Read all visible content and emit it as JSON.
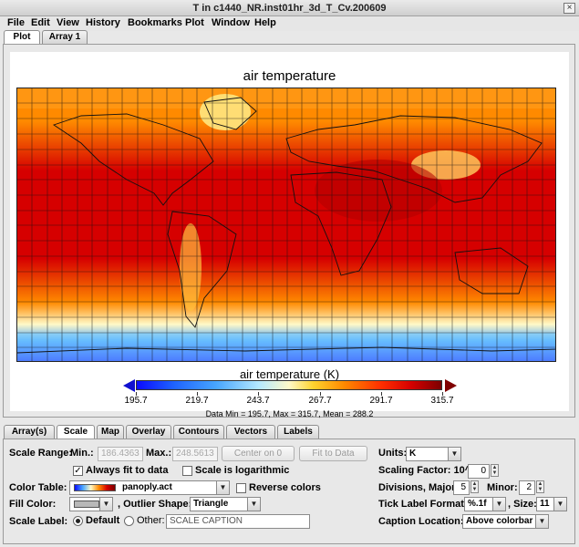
{
  "window": {
    "title": "T in c1440_NR.inst01hr_3d_T_Cv.200609",
    "close_glyph": "×"
  },
  "menu": [
    "File",
    "Edit",
    "View",
    "History",
    "Bookmarks",
    "Plot",
    "Window",
    "Help"
  ],
  "top_tabs": [
    "Plot",
    "Array 1"
  ],
  "plot": {
    "title": "air temperature",
    "colorbar_title": "air temperature (K)",
    "colorbar_ticks": [
      "195.7",
      "219.7",
      "243.7",
      "267.7",
      "291.7",
      "315.7"
    ],
    "stats": "Data Min = 195.7, Max = 315.7, Mean = 288.2",
    "colors": {
      "cold": "#0b0bff",
      "cool": "#47a5ff",
      "mid": "#fff9c8",
      "warm": "#ff8a00",
      "hot": "#d60000",
      "hottest": "#7c0000"
    }
  },
  "bottom_tabs": [
    "Array(s)",
    "Scale",
    "Map",
    "Overlay",
    "Contours",
    "Vectors",
    "Labels"
  ],
  "scale": {
    "range_label": "Scale Range:",
    "min_label": "Min.:",
    "min_value": "186.4363",
    "max_label": "Max.:",
    "max_value": "248.5613",
    "center_button": "Center on 0",
    "fit_button": "Fit to Data",
    "always_fit": "Always fit to data",
    "always_fit_checked": true,
    "logarithmic": "Scale is logarithmic",
    "logarithmic_checked": false,
    "color_table_label": "Color Table:",
    "color_table": "panoply.act",
    "reverse_colors": "Reverse colors",
    "reverse_checked": false,
    "fill_color_label": "Fill Color:",
    "outlier_label": "Outlier Shape:",
    "outlier_shape": "Triangle",
    "scale_label_label": "Scale Label:",
    "default_option": "Default",
    "other_option": "Other:",
    "caption_placeholder": "SCALE CAPTION",
    "units_label": "Units:",
    "units_value": "K",
    "scaling_factor_label": "Scaling Factor: 10^",
    "scaling_factor_value": "0",
    "divisions_label": "Divisions, Major:",
    "major_value": "5",
    "minor_label": "Minor:",
    "minor_value": "2",
    "tick_format_label": "Tick Label Format:",
    "tick_format": "%.1f",
    "size_label": "Size:",
    "size_value": "11",
    "caption_location_label": "Caption Location:",
    "caption_location": "Above colorbar"
  },
  "glyphs": {
    "check": "✓",
    "down": "▼",
    "up": "▲"
  }
}
